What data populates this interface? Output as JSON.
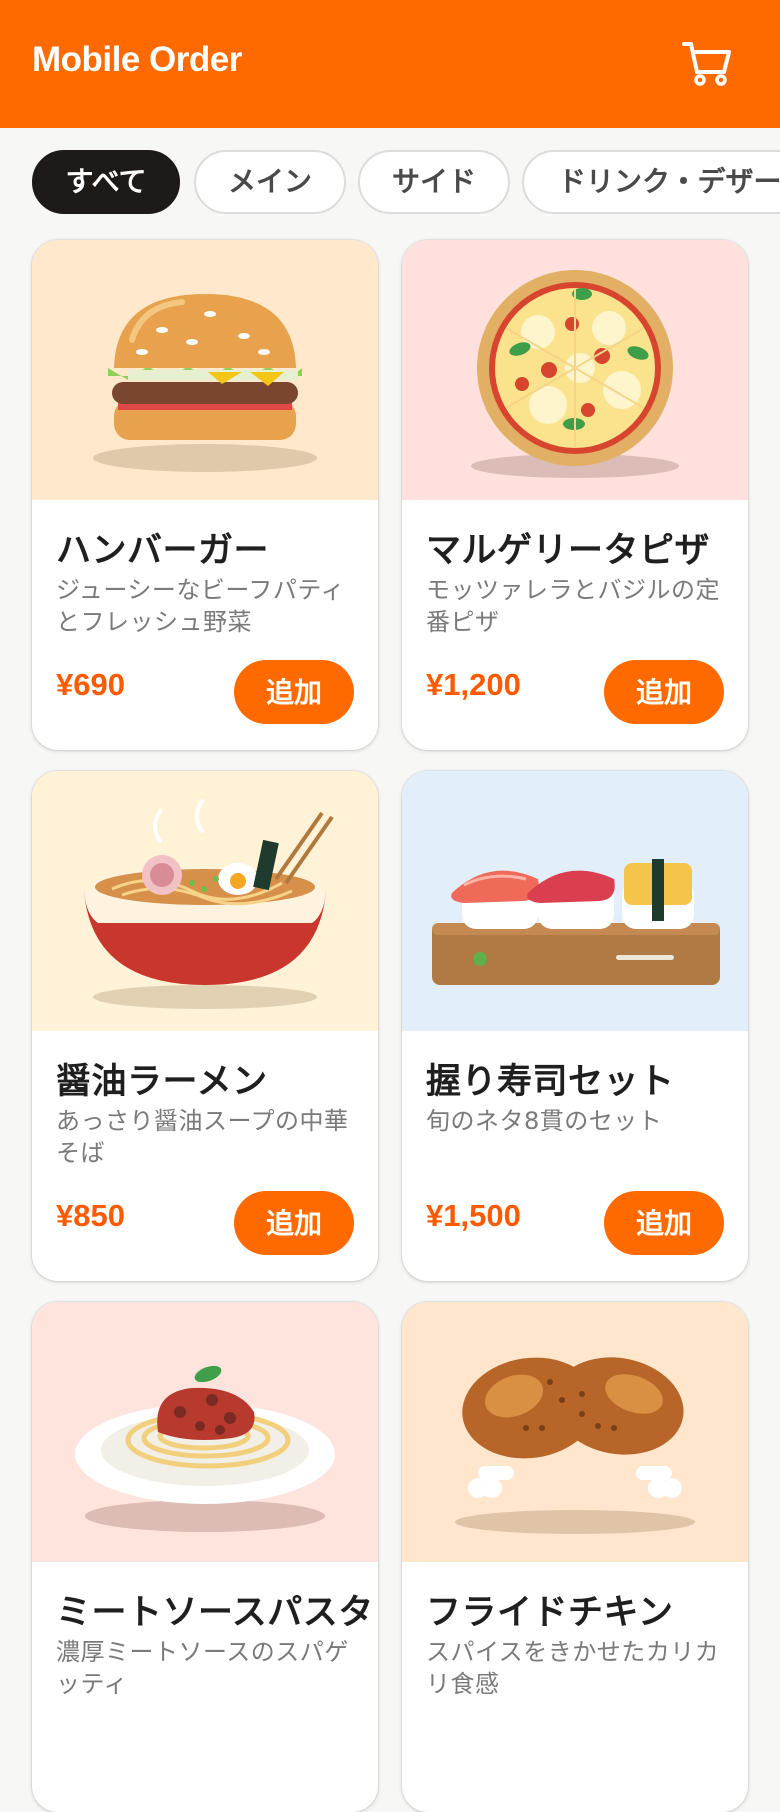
{
  "header": {
    "title": "Mobile Order",
    "cart_icon": "cart-icon",
    "background": "#ff6a00"
  },
  "tabs": [
    {
      "label": "すべて",
      "active": true
    },
    {
      "label": "メイン",
      "active": false
    },
    {
      "label": "サイド",
      "active": false
    },
    {
      "label": "ドリンク・デザート",
      "active": false
    }
  ],
  "menu": {
    "add_label": "追加",
    "items": [
      {
        "name": "ハンバーガー",
        "description": "ジューシーなビーフパティとフレッシュ野菜",
        "price": "¥690",
        "image": "hamburger-image"
      },
      {
        "name": "マルゲリータピザ",
        "description": "モッツァレラとバジルの定番ピザ",
        "price": "¥1,200",
        "image": "pizza-image"
      },
      {
        "name": "醤油ラーメン",
        "description": "あっさり醤油スープの中華そば",
        "price": "¥850",
        "image": "ramen-image"
      },
      {
        "name": "握り寿司セット",
        "description": "旬のネタ8貫のセット",
        "price": "¥1,500",
        "image": "sushi-image"
      },
      {
        "name": "ミートソースパスタ",
        "description": "濃厚ミートソースのスパゲッティ",
        "price": "",
        "image": "pasta-image"
      },
      {
        "name": "フライドチキン",
        "description": "スパイスをきかせたカリカリ食感",
        "price": "",
        "image": "fried-chicken-image"
      }
    ]
  },
  "colors": {
    "accent": "#ff6a00",
    "price": "#ff5a00",
    "active_tab": "#1d1a18"
  }
}
